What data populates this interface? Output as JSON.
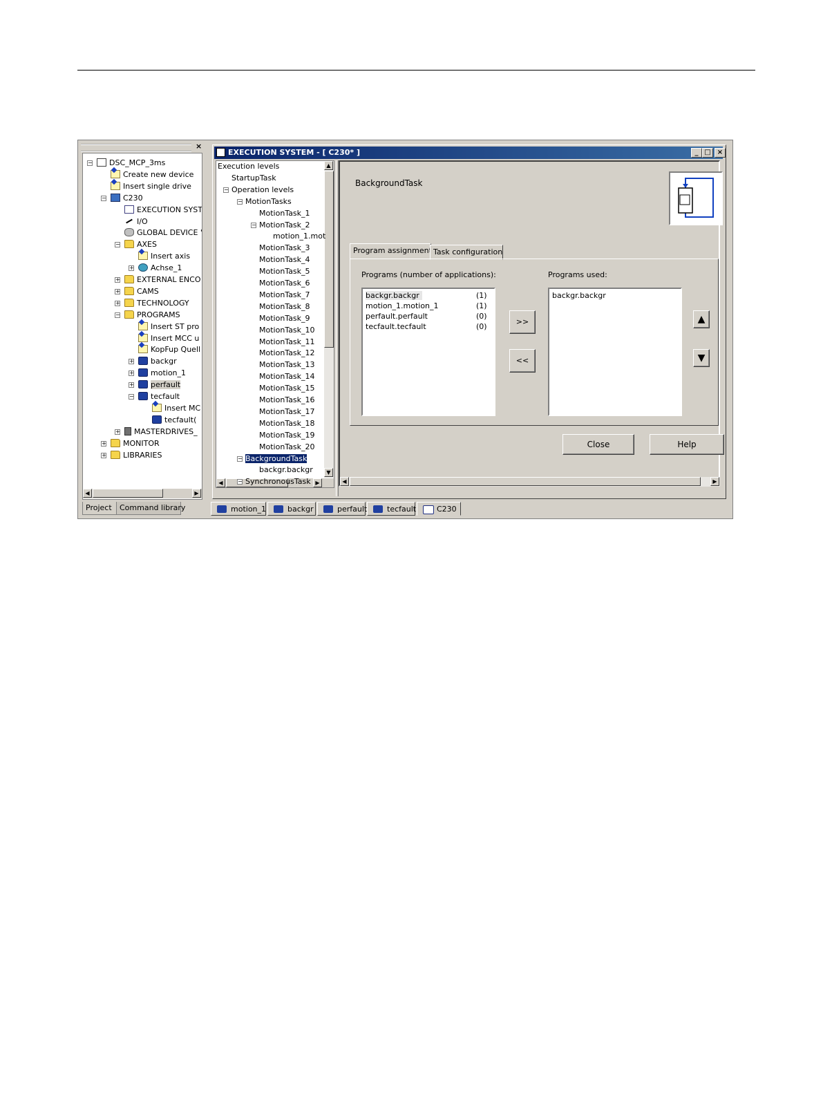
{
  "project_tree": {
    "nodes": [
      {
        "label": "DSC_MCP_3ms",
        "icon": "project-icon",
        "pm": "−"
      },
      {
        "label": "Create new device",
        "icon": "insert-icon"
      },
      {
        "label": "Insert single drive",
        "icon": "insert-icon"
      },
      {
        "label": "C230",
        "icon": "device-icon",
        "pm": "−"
      },
      {
        "label": "EXECUTION SYST",
        "icon": "execution-system-icon"
      },
      {
        "label": "I/O",
        "icon": "io-icon"
      },
      {
        "label": "GLOBAL DEVICE '",
        "icon": "database-icon"
      },
      {
        "label": "AXES",
        "icon": "folder-icon",
        "pm": "−"
      },
      {
        "label": "Insert axis",
        "icon": "insert-icon"
      },
      {
        "label": "Achse_1",
        "icon": "axis-icon",
        "pm": "+"
      },
      {
        "label": "EXTERNAL ENCO",
        "icon": "folder-icon",
        "pm": "+"
      },
      {
        "label": "CAMS",
        "icon": "folder-icon",
        "pm": "+"
      },
      {
        "label": "TECHNOLOGY",
        "icon": "folder-icon",
        "pm": "+"
      },
      {
        "label": "PROGRAMS",
        "icon": "folder-icon",
        "pm": "−"
      },
      {
        "label": "Insert ST pro",
        "icon": "insert-icon"
      },
      {
        "label": "Insert MCC u",
        "icon": "insert-icon"
      },
      {
        "label": "KopFup Quell",
        "icon": "insert-icon"
      },
      {
        "label": "backgr",
        "icon": "program-icon",
        "pm": "+"
      },
      {
        "label": "motion_1",
        "icon": "program-icon",
        "pm": "+"
      },
      {
        "label": "perfault",
        "icon": "program-icon",
        "pm": "+"
      },
      {
        "label": "tecfault",
        "icon": "program-icon",
        "pm": "−"
      },
      {
        "label": "Insert MC",
        "icon": "insert-icon"
      },
      {
        "label": "tecfault(",
        "icon": "program-icon"
      },
      {
        "label": "MASTERDRIVES_",
        "icon": "masterdrives-icon",
        "pm": "+"
      },
      {
        "label": "MONITOR",
        "icon": "folder-icon",
        "pm": "+"
      },
      {
        "label": "LIBRARIES",
        "icon": "folder-icon",
        "pm": "+"
      }
    ],
    "tabs": [
      "Project",
      "Command library"
    ]
  },
  "window": {
    "title": "EXECUTION SYSTEM - [ C230* ]",
    "controls": {
      "minimize": "_",
      "maximize": "□",
      "close": "×"
    }
  },
  "exec_tree": {
    "nodes": [
      {
        "label": "Execution levels"
      },
      {
        "label": "StartupTask"
      },
      {
        "label": "Operation levels",
        "pm": "−"
      },
      {
        "label": "MotionTasks",
        "pm": "−"
      },
      {
        "label": "MotionTask_1"
      },
      {
        "label": "MotionTask_2",
        "pm": "−"
      },
      {
        "label": "motion_1.mot"
      },
      {
        "label": "MotionTask_3"
      },
      {
        "label": "MotionTask_4"
      },
      {
        "label": "MotionTask_5"
      },
      {
        "label": "MotionTask_6"
      },
      {
        "label": "MotionTask_7"
      },
      {
        "label": "MotionTask_8"
      },
      {
        "label": "MotionTask_9"
      },
      {
        "label": "MotionTask_10"
      },
      {
        "label": "MotionTask_11"
      },
      {
        "label": "MotionTask_12"
      },
      {
        "label": "MotionTask_13"
      },
      {
        "label": "MotionTask_14"
      },
      {
        "label": "MotionTask_15"
      },
      {
        "label": "MotionTask_16"
      },
      {
        "label": "MotionTask_17"
      },
      {
        "label": "MotionTask_18"
      },
      {
        "label": "MotionTask_19"
      },
      {
        "label": "MotionTask_20"
      },
      {
        "label": "BackgroundTask",
        "pm": "−"
      },
      {
        "label": "backgr.backgr"
      },
      {
        "label": "SynchronousTask",
        "pm": "−"
      }
    ]
  },
  "task_panel": {
    "task_name": "BackgroundTask",
    "tabs": [
      "Program assignment",
      "Task configuration"
    ],
    "programs_label": "Programs (number of applications):",
    "programs": [
      {
        "name": "backgr.backgr",
        "count": "(1)"
      },
      {
        "name": "motion_1.motion_1",
        "count": "(1)"
      },
      {
        "name": "perfault.perfault",
        "count": "(0)"
      },
      {
        "name": "tecfault.tecfault",
        "count": "(0)"
      }
    ],
    "used_label": "Programs used:",
    "used": [
      "backgr.backgr"
    ],
    "add_button": ">>",
    "remove_button": "<<",
    "up_button": "▲",
    "down_button": "▼",
    "close_button": "Close",
    "help_button": "Help"
  },
  "bottom_tabs": [
    "motion_1",
    "backgr",
    "perfault",
    "tecfault",
    "C230"
  ]
}
